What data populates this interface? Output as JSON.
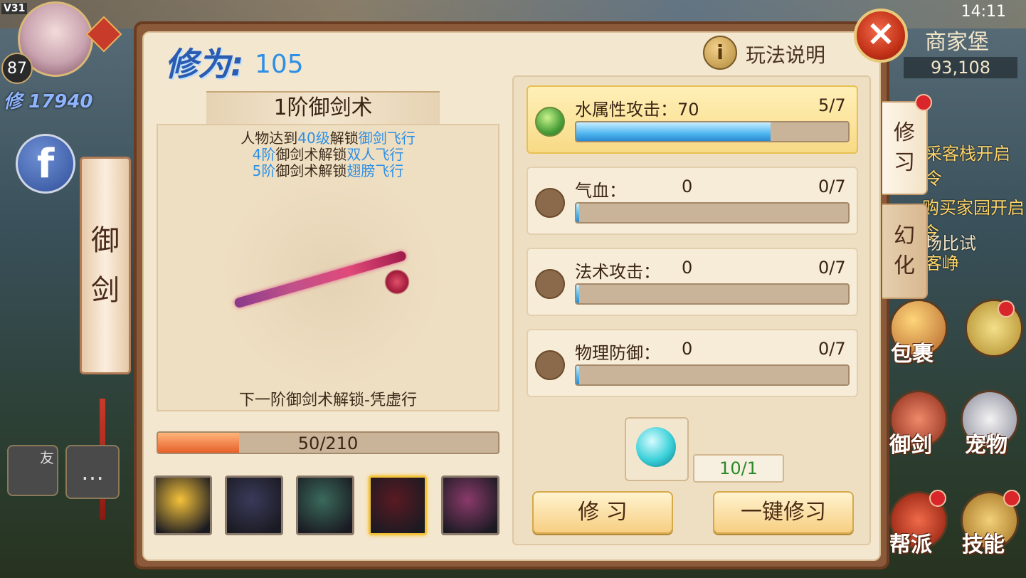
{
  "status_bar": {
    "version": "V31",
    "time": "14:11"
  },
  "player": {
    "level": "87",
    "power": "修 17940"
  },
  "left_hud": {
    "sword_tag": [
      "御",
      "剑"
    ],
    "friend": "友",
    "facebook": "f"
  },
  "right_hud": {
    "name": "商家堡",
    "money": "93,108",
    "quests": [
      "采客栈开启令",
      "购买家园开启令",
      "场比试",
      "客峥"
    ],
    "menu": [
      "包裹",
      "御剑",
      "宠物",
      "帮派",
      "技能"
    ]
  },
  "panel": {
    "xiuwei_label": "修为:",
    "xiuwei_value": "105",
    "help": "玩法说明",
    "tabs": [
      {
        "label": [
          "修",
          "习"
        ]
      },
      {
        "label": [
          "幻",
          "化"
        ]
      }
    ],
    "level_title": "1阶御剑术",
    "unlocks": [
      {
        "a": "人物达到",
        "b": "40级",
        "c": "解锁",
        "d": "御剑飞行"
      },
      {
        "a": "",
        "b": "4阶",
        "c": "御剑术解锁",
        "d": "双人飞行"
      },
      {
        "a": "",
        "b": "5阶",
        "c": "御剑术解锁",
        "d": "翅膀飞行"
      }
    ],
    "next_unlock": "下一阶御剑术解锁-凭虚行",
    "exp": {
      "text": "50/210",
      "fraction": 0.238
    },
    "skills": [
      {
        "icon": "wing-icon",
        "color": "#f5c23a"
      },
      {
        "icon": "swords-icon",
        "color": "#3a3a5a"
      },
      {
        "icon": "fighter-icon",
        "color": "#3a6a5a"
      },
      {
        "icon": "blade-icon",
        "color": "#5a1a22"
      },
      {
        "icon": "rose-icon",
        "color": "#8a3a6a"
      }
    ],
    "attributes": [
      {
        "name": "水属性攻击：70",
        "value": "",
        "progress": "5/7",
        "fraction": 0.714,
        "active": true
      },
      {
        "name": "气血：",
        "value": "0",
        "progress": "0/7",
        "fraction": 0.0,
        "active": false
      },
      {
        "name": "法术攻击：",
        "value": "0",
        "progress": "0/7",
        "fraction": 0.0,
        "active": false
      },
      {
        "name": "物理防御：",
        "value": "0",
        "progress": "0/7",
        "fraction": 0.0,
        "active": false
      }
    ],
    "orb_count": "10/1",
    "buttons": {
      "study": "修 习",
      "one_click": "一键修习"
    }
  }
}
